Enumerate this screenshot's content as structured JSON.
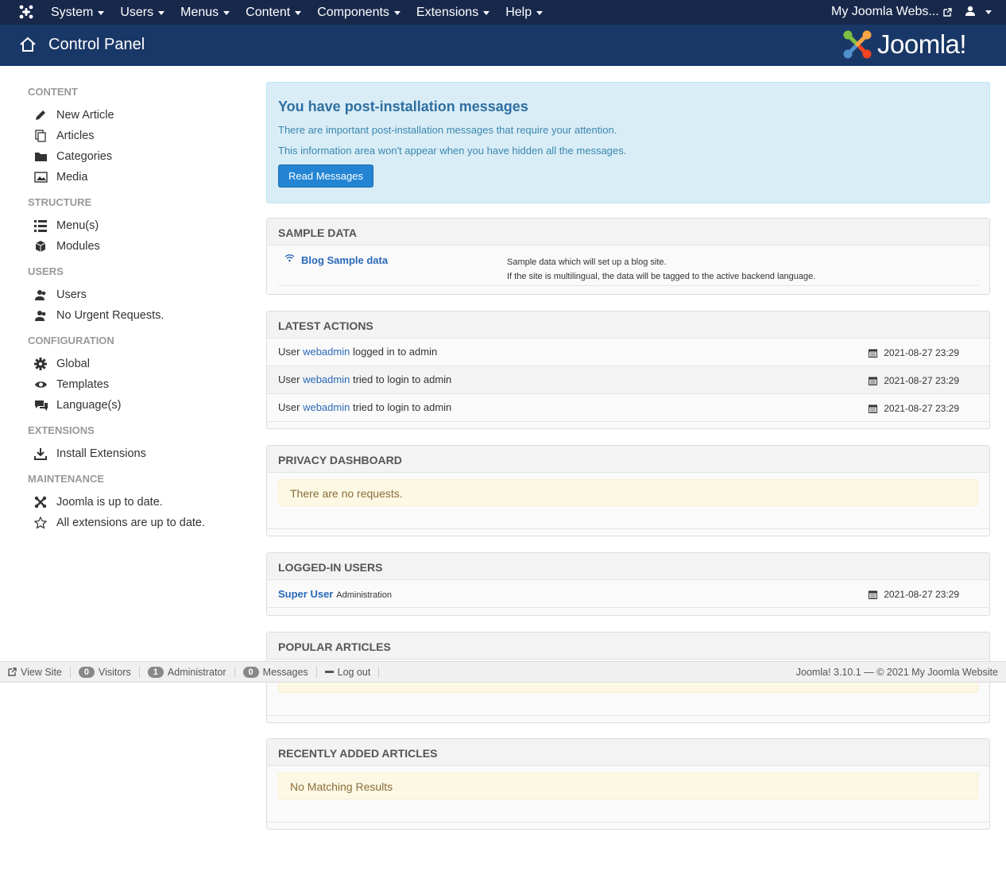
{
  "topbar": {
    "menu": [
      "System",
      "Users",
      "Menus",
      "Content",
      "Components",
      "Extensions",
      "Help"
    ],
    "site_link": "My Joomla Webs...",
    "user_icon": "user-icon"
  },
  "header": {
    "title": "Control Panel",
    "brand": "Joomla!"
  },
  "sidebar": {
    "groups": [
      {
        "heading": "CONTENT",
        "items": [
          {
            "label": "New Article",
            "icon": "pencil-icon"
          },
          {
            "label": "Articles",
            "icon": "copy-icon"
          },
          {
            "label": "Categories",
            "icon": "folder-icon"
          },
          {
            "label": "Media",
            "icon": "image-icon"
          }
        ]
      },
      {
        "heading": "STRUCTURE",
        "items": [
          {
            "label": "Menu(s)",
            "icon": "list-icon"
          },
          {
            "label": "Modules",
            "icon": "cube-icon"
          }
        ]
      },
      {
        "heading": "USERS",
        "items": [
          {
            "label": "Users",
            "icon": "users-icon"
          },
          {
            "label": "No Urgent Requests.",
            "icon": "users-icon"
          }
        ]
      },
      {
        "heading": "CONFIGURATION",
        "items": [
          {
            "label": "Global",
            "icon": "gear-icon"
          },
          {
            "label": "Templates",
            "icon": "eye-icon"
          },
          {
            "label": "Language(s)",
            "icon": "comments-icon"
          }
        ]
      },
      {
        "heading": "EXTENSIONS",
        "items": [
          {
            "label": "Install Extensions",
            "icon": "download-icon"
          }
        ]
      },
      {
        "heading": "MAINTENANCE",
        "items": [
          {
            "label": "Joomla is up to date.",
            "icon": "joomla-icon"
          },
          {
            "label": "All extensions are up to date.",
            "icon": "star-icon"
          }
        ]
      }
    ]
  },
  "postinstall": {
    "title": "You have post-installation messages",
    "line1": "There are important post-installation messages that require your attention.",
    "line2": "This information area won't appear when you have hidden all the messages.",
    "button": "Read Messages"
  },
  "sample_data": {
    "title": "SAMPLE DATA",
    "name": "Blog Sample data",
    "desc1": "Sample data which will set up a blog site.",
    "desc2": "If the site is multilingual, the data will be tagged to the active backend language."
  },
  "latest_actions": {
    "title": "LATEST ACTIONS",
    "rows": [
      {
        "prefix": "User",
        "user": "webadmin",
        "action": "logged in to admin",
        "date": "2021-08-27 23:29"
      },
      {
        "prefix": "User",
        "user": "webadmin",
        "action": "tried to login to admin",
        "date": "2021-08-27 23:29"
      },
      {
        "prefix": "User",
        "user": "webadmin",
        "action": "tried to login to admin",
        "date": "2021-08-27 23:29"
      }
    ]
  },
  "privacy": {
    "title": "PRIVACY DASHBOARD",
    "message": "There are no requests."
  },
  "logged_in": {
    "title": "LOGGED-IN USERS",
    "user": "Super User",
    "role": "Administration",
    "date": "2021-08-27 23:29"
  },
  "popular": {
    "title": "POPULAR ARTICLES"
  },
  "recent": {
    "title": "RECENTLY ADDED ARTICLES",
    "message": "No Matching Results"
  },
  "statusbar": {
    "view_site": "View Site",
    "visitors_count": "0",
    "visitors": "Visitors",
    "admin_count": "1",
    "admin": "Administrator",
    "messages_count": "0",
    "messages": "Messages",
    "logout": "Log out",
    "version": "Joomla! 3.10.1  —  © 2021 My Joomla Website"
  }
}
